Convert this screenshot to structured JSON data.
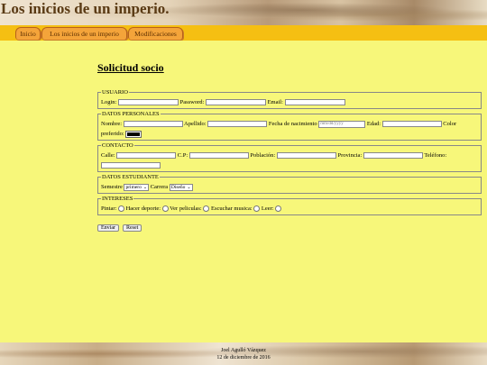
{
  "header": {
    "title": "Los inicios de un imperio."
  },
  "nav": {
    "tabs": [
      {
        "label": "Inicio"
      },
      {
        "label": "Los inicios de un imperio"
      },
      {
        "label": "Modificaciones"
      }
    ]
  },
  "form": {
    "title": "Solicitud socio",
    "usuario": {
      "legend": "USUARIO",
      "login_label": "Login:",
      "password_label": "Password:",
      "email_label": "Email:"
    },
    "datos_personales": {
      "legend": "DATOS PERSONALES",
      "nombre_label": "Nombre:",
      "apellido_label": "Apellido:",
      "fecha_label": "Fecha de nacimiento",
      "fecha_placeholder": "mm/dd/yyyy",
      "edad_label": "Edad:",
      "color_label": "Color preferido:",
      "color_value": "#000000"
    },
    "contacto": {
      "legend": "CONTACTO",
      "calle_label": "Calle:",
      "cp_label": "C.P:",
      "poblacion_label": "Población:",
      "provincia_label": "Provincia:",
      "telefono_label": "Teléfono:"
    },
    "datos_estudiante": {
      "legend": "DATOS ESTUDIANTE",
      "semestre_label": "Semestre",
      "semestre_value": "primero",
      "carrera_label": "Carrera",
      "carrera_value": "Diseño"
    },
    "intereses": {
      "legend": "INTERESES",
      "options": [
        "Pintar:",
        "Hacer deporte:",
        "Ver peliculas:",
        "Escuchar musica:",
        "Leer:"
      ]
    },
    "buttons": {
      "submit": "Enviar",
      "reset": "Reset"
    }
  },
  "footer": {
    "author": "Joel Agulló Vázquez",
    "date": "12 de diciembre de 2016"
  }
}
